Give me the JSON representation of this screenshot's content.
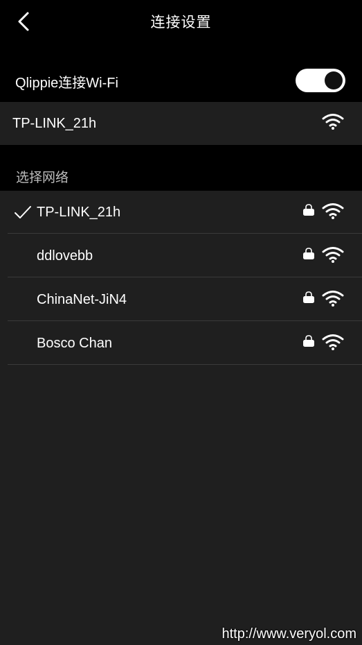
{
  "header": {
    "title": "连接设置",
    "back_icon": "chevron-left-icon"
  },
  "wifi_toggle": {
    "label": "Qlippie连接Wi-Fi",
    "enabled": true
  },
  "current_network": {
    "name": "TP-LINK_21h",
    "icon": "wifi-icon"
  },
  "network_list": {
    "section_label": "选择网络",
    "networks": [
      {
        "name": "TP-LINK_21h",
        "selected": true,
        "locked": true
      },
      {
        "name": "ddlovebb",
        "selected": false,
        "locked": true
      },
      {
        "name": "ChinaNet-JiN4",
        "selected": false,
        "locked": true
      },
      {
        "name": "Bosco Chan",
        "selected": false,
        "locked": true
      }
    ]
  },
  "watermark": "http://www.veryol.com",
  "colors": {
    "background": "#000000",
    "row_background": "#1f1f1f",
    "text": "#ffffff",
    "section_text": "#bdbdbd",
    "divider": "#3a3a3a"
  }
}
